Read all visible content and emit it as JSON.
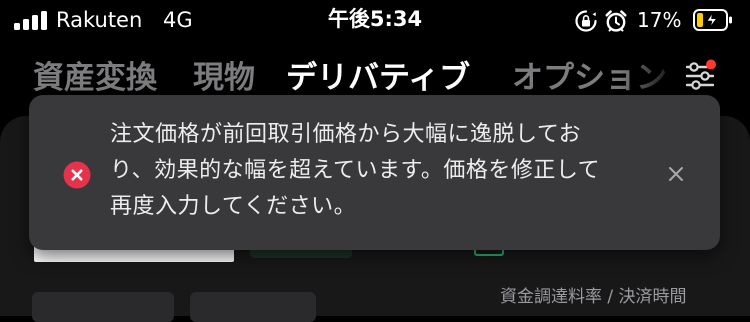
{
  "status_bar": {
    "carrier": "Rakuten",
    "network": "4G",
    "time": "午後5:34",
    "battery_percent": "17%",
    "icons": [
      "signal-icon",
      "orientation-lock-icon",
      "alarm-icon",
      "battery-charging-icon"
    ]
  },
  "tabs": [
    {
      "label": "資産変換"
    },
    {
      "label": "現物"
    },
    {
      "label": "デリバティブ"
    },
    {
      "label": "オプション"
    }
  ],
  "active_tab": "デリバティブ",
  "settings_icon": "settings-sliders-icon",
  "background": {
    "funding_label": "資金調達料率 / 決済時間"
  },
  "toast": {
    "message": "注文価格が前回取引価格から大幅に逸脱してお\nり、効果的な幅を超えています。価格を修正して\n再度入力してください。",
    "icon": "error-icon",
    "close_icon": "close-icon"
  },
  "colors": {
    "background": "#000000",
    "toast_bg": "#39393b",
    "error_red": "#e5334b",
    "notification_dot": "#ff3b30",
    "accent_green": "#2bb673",
    "battery_low": "#ffcc00"
  }
}
